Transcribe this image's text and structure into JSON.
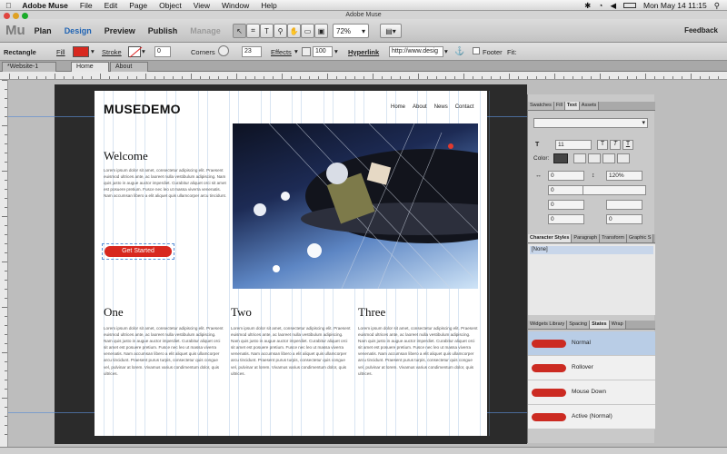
{
  "menubar": {
    "app": "Adobe Muse",
    "menus": [
      "File",
      "Edit",
      "Page",
      "Object",
      "View",
      "Window",
      "Help"
    ],
    "clock": "Mon May 14  11:15"
  },
  "window_title": "Adobe Muse",
  "modebar": {
    "logo": "Mu",
    "tabs": [
      "Plan",
      "Design",
      "Preview",
      "Publish",
      "Manage"
    ],
    "active_tab": "Design",
    "zoom": "72%",
    "feedback": "Feedback"
  },
  "controlbar": {
    "selection": "Rectangle",
    "fill_label": "Fill",
    "fill_color": "#d8281f",
    "stroke_label": "Stroke",
    "stroke_value": "0",
    "corners_label": "Corners",
    "corners_value": "23",
    "effects_label": "Effects",
    "opacity": "100",
    "hyperlink_label": "Hyperlink",
    "hyperlink_value": "http://www.desig",
    "footer_label": "Footer",
    "fit_label": "Fit:"
  },
  "doctabs": [
    "*Website-1",
    "Home",
    "About"
  ],
  "site": {
    "logo": "MUSEDEMO",
    "nav": [
      "Home",
      "About",
      "News",
      "Contact"
    ],
    "welcome_title": "Welcome",
    "welcome_body": "Lorem ipsum dolor sit amet, consectetur adipiscing elit. Praesent euismod ultrices ante, ac laoreet nulla vestibulum adipiscing. Nam quis justo in augue auctor imperdiet. Curabitur aliquet orci sit amet est posuere pretium. Fusce nec leo ut massa viverra venenatis. Nam accumsan libero a elit aliquet quis ullamcorper arcu tincidunt.",
    "cta": "Get Started",
    "columns": [
      {
        "title": "One",
        "body": "Lorem ipsum dolor sit amet, consectetur adipiscing elit. Praesent euismod ultrices ante, ac laoreet nulla vestibulum adipiscing. Nam quis justo in augue auctor imperdiet. Curabitur aliquet orci sit amet est posuere pretium. Fusce nec leo ut massa viverra venenatis. Nam accumsan libero a elit aliquet quis ullamcorper arcu tincidunt. Praesent purus turpis, consectetur quis congue vel, pulvinar at lorem. Vivamus varius condimentum dolor, quis ultrices."
      },
      {
        "title": "Two",
        "body": "Lorem ipsum dolor sit amet, consectetur adipiscing elit. Praesent euismod ultrices ante, ac laoreet nulla vestibulum adipiscing. Nam quis justo in augue auctor imperdiet. Curabitur aliquet orci sit amet est posuere pretium. Fusce nec leo ut massa viverra venenatis. Nam accumsan libero a elit aliquet quis ullamcorper arcu tincidunt. Praesent purus turpis, consectetur quis congue vel, pulvinar at lorem. Vivamus varius condimentum dolor, quis ultrices."
      },
      {
        "title": "Three",
        "body": "Lorem ipsum dolor sit amet, consectetur adipiscing elit. Praesent euismod ultrices ante, ac laoreet nulla vestibulum adipiscing. Nam quis justo in augue auctor imperdiet. Curabitur aliquet orci sit amet est posuere pretium. Fusce nec leo ut massa viverra venenatis. Nam accumsan libero a elit aliquet quis ullamcorper arcu tincidunt. Praesent purus turpis, consectetur quis congue vel, pulvinar at lorem. Vivamus varius condimentum dolor, quis ultrices."
      }
    ]
  },
  "panel": {
    "top_tabs": [
      "Swatches",
      "Fill",
      "Text",
      "Assets"
    ],
    "active_top_tab": "Text",
    "font_size": "11",
    "color_label": "Color:",
    "tracking": "0",
    "leading": "120%",
    "indent_values": [
      "0",
      "0",
      "0",
      "0"
    ],
    "mid_tabs": [
      "Character Styles",
      "Paragraph",
      "Transform",
      "Graphic S"
    ],
    "style_item": "[None]",
    "state_tabs": [
      "Widgets Library",
      "Spacing",
      "States",
      "Wrap"
    ],
    "active_state_tab": "States",
    "states": [
      "Normal",
      "Rollover",
      "Mouse Down",
      "Active (Normal)"
    ]
  }
}
